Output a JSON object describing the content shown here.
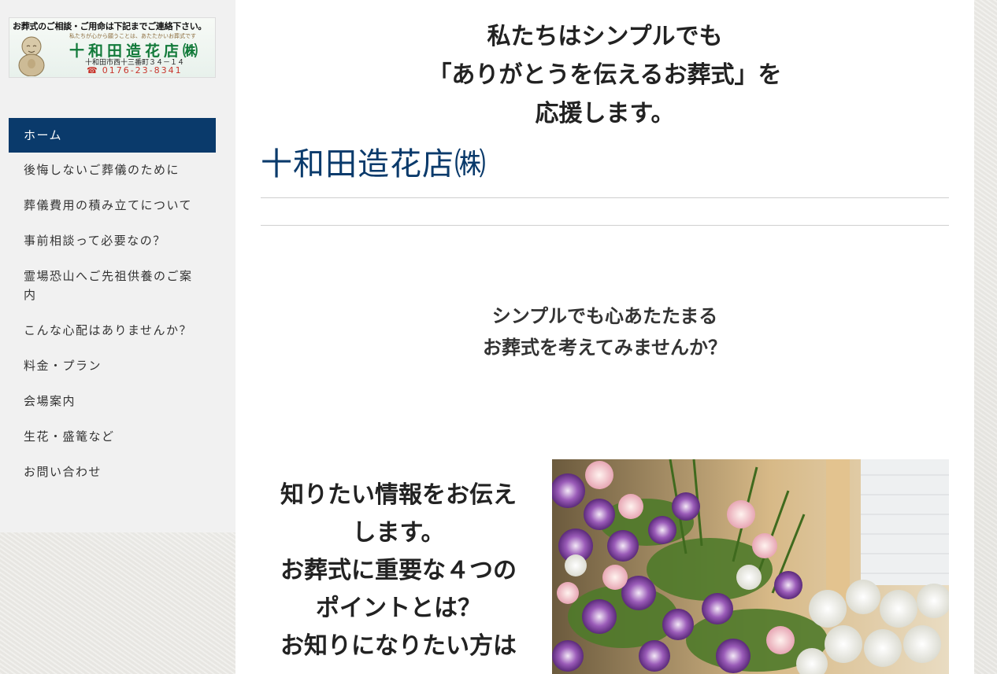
{
  "logo": {
    "top_text": "お葬式のご相談・ご用命は下記までご連絡下さい。",
    "sub_text": "私たちが心から願うことは、あたたかいお葬式です",
    "name": "十和田造花店㈱",
    "address": "十和田市西十三番町３４－１４",
    "tel": "0176-23-8341",
    "tel_icon": "phone-icon"
  },
  "nav": {
    "items": [
      {
        "label": "ホーム",
        "active": true
      },
      {
        "label": "後悔しないご葬儀のために"
      },
      {
        "label": "葬儀費用の積み立てについて"
      },
      {
        "label": "事前相談って必要なの？"
      },
      {
        "label": "霊場恐山へご先祖供養のご案内"
      },
      {
        "label": "こんな心配はありませんか？"
      },
      {
        "label": "料金・プラン"
      },
      {
        "label": "会場案内"
      },
      {
        "label": "生花・盛篭など"
      },
      {
        "label": "お問い合わせ"
      }
    ]
  },
  "hero": {
    "line1": "私たちはシンプルでも",
    "line2": "「ありがとうを伝えるお葬式」を",
    "line3": "応援します。"
  },
  "site_title": "十和田造花店㈱",
  "tagline": {
    "line1": "シンプルでも心あたたまる",
    "line2": "お葬式を考えてみませんか？"
  },
  "info": {
    "line1": "知りたい情報をお伝え",
    "line2": "します。",
    "line3": "お葬式に重要な４つの",
    "line4": "ポイントとは？",
    "line5": "お知りになりたい方は"
  },
  "colors": {
    "nav_active_bg": "#0a3a6b",
    "title": "#0a3a6b",
    "logo_name": "#127a3a",
    "logo_tel": "#c8332a"
  }
}
